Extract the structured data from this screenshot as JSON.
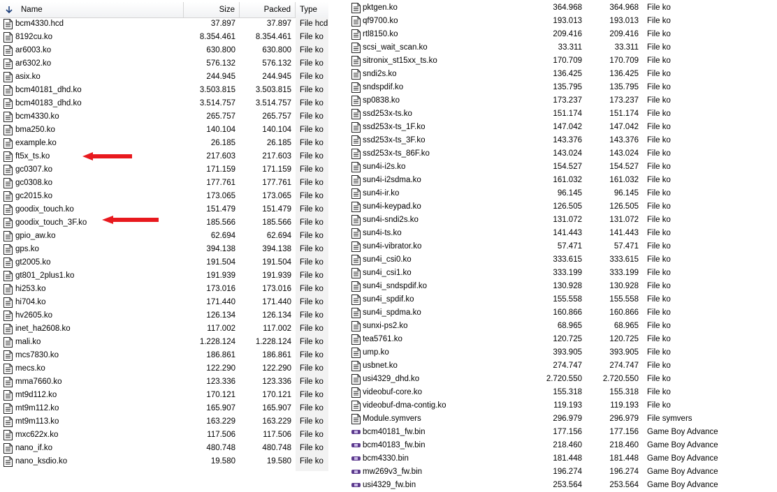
{
  "colors": {
    "annotation_arrow": "#e8191e",
    "gameboy_icon": "#5c3a8c",
    "type_column_shade": "#f2f2f2"
  },
  "header": {
    "name_label": "Name",
    "size_label": "Size",
    "packed_label": "Packed",
    "type_label": "Type",
    "sort_icon": "sort-down-arrow-icon"
  },
  "left_files": [
    {
      "name": "bcm4330.hcd",
      "size": "37.897",
      "packed": "37.897",
      "type": "File hcd",
      "icon": "document"
    },
    {
      "name": "8192cu.ko",
      "size": "8.354.461",
      "packed": "8.354.461",
      "type": "File ko",
      "icon": "document"
    },
    {
      "name": "ar6003.ko",
      "size": "630.800",
      "packed": "630.800",
      "type": "File ko",
      "icon": "document"
    },
    {
      "name": "ar6302.ko",
      "size": "576.132",
      "packed": "576.132",
      "type": "File ko",
      "icon": "document"
    },
    {
      "name": "asix.ko",
      "size": "244.945",
      "packed": "244.945",
      "type": "File ko",
      "icon": "document"
    },
    {
      "name": "bcm40181_dhd.ko",
      "size": "3.503.815",
      "packed": "3.503.815",
      "type": "File ko",
      "icon": "document"
    },
    {
      "name": "bcm40183_dhd.ko",
      "size": "3.514.757",
      "packed": "3.514.757",
      "type": "File ko",
      "icon": "document"
    },
    {
      "name": "bcm4330.ko",
      "size": "265.757",
      "packed": "265.757",
      "type": "File ko",
      "icon": "document"
    },
    {
      "name": "bma250.ko",
      "size": "140.104",
      "packed": "140.104",
      "type": "File ko",
      "icon": "document"
    },
    {
      "name": "example.ko",
      "size": "26.185",
      "packed": "26.185",
      "type": "File ko",
      "icon": "document"
    },
    {
      "name": "ft5x_ts.ko",
      "size": "217.603",
      "packed": "217.603",
      "type": "File ko",
      "icon": "document"
    },
    {
      "name": "gc0307.ko",
      "size": "171.159",
      "packed": "171.159",
      "type": "File ko",
      "icon": "document"
    },
    {
      "name": "gc0308.ko",
      "size": "177.761",
      "packed": "177.761",
      "type": "File ko",
      "icon": "document"
    },
    {
      "name": "gc2015.ko",
      "size": "173.065",
      "packed": "173.065",
      "type": "File ko",
      "icon": "document"
    },
    {
      "name": "goodix_touch.ko",
      "size": "151.479",
      "packed": "151.479",
      "type": "File ko",
      "icon": "document"
    },
    {
      "name": "goodix_touch_3F.ko",
      "size": "185.566",
      "packed": "185.566",
      "type": "File ko",
      "icon": "document"
    },
    {
      "name": "gpio_aw.ko",
      "size": "62.694",
      "packed": "62.694",
      "type": "File ko",
      "icon": "document"
    },
    {
      "name": "gps.ko",
      "size": "394.138",
      "packed": "394.138",
      "type": "File ko",
      "icon": "document"
    },
    {
      "name": "gt2005.ko",
      "size": "191.504",
      "packed": "191.504",
      "type": "File ko",
      "icon": "document"
    },
    {
      "name": "gt801_2plus1.ko",
      "size": "191.939",
      "packed": "191.939",
      "type": "File ko",
      "icon": "document"
    },
    {
      "name": "hi253.ko",
      "size": "173.016",
      "packed": "173.016",
      "type": "File ko",
      "icon": "document"
    },
    {
      "name": "hi704.ko",
      "size": "171.440",
      "packed": "171.440",
      "type": "File ko",
      "icon": "document"
    },
    {
      "name": "hv2605.ko",
      "size": "126.134",
      "packed": "126.134",
      "type": "File ko",
      "icon": "document"
    },
    {
      "name": "inet_ha2608.ko",
      "size": "117.002",
      "packed": "117.002",
      "type": "File ko",
      "icon": "document"
    },
    {
      "name": "mali.ko",
      "size": "1.228.124",
      "packed": "1.228.124",
      "type": "File ko",
      "icon": "document"
    },
    {
      "name": "mcs7830.ko",
      "size": "186.861",
      "packed": "186.861",
      "type": "File ko",
      "icon": "document"
    },
    {
      "name": "mecs.ko",
      "size": "122.290",
      "packed": "122.290",
      "type": "File ko",
      "icon": "document"
    },
    {
      "name": "mma7660.ko",
      "size": "123.336",
      "packed": "123.336",
      "type": "File ko",
      "icon": "document"
    },
    {
      "name": "mt9d112.ko",
      "size": "170.121",
      "packed": "170.121",
      "type": "File ko",
      "icon": "document"
    },
    {
      "name": "mt9m112.ko",
      "size": "165.907",
      "packed": "165.907",
      "type": "File ko",
      "icon": "document"
    },
    {
      "name": "mt9m113.ko",
      "size": "163.229",
      "packed": "163.229",
      "type": "File ko",
      "icon": "document"
    },
    {
      "name": "mxc622x.ko",
      "size": "117.506",
      "packed": "117.506",
      "type": "File ko",
      "icon": "document"
    },
    {
      "name": "nano_if.ko",
      "size": "480.748",
      "packed": "480.748",
      "type": "File ko",
      "icon": "document"
    },
    {
      "name": "nano_ksdio.ko",
      "size": "19.580",
      "packed": "19.580",
      "type": "File ko",
      "icon": "document"
    }
  ],
  "right_files": [
    {
      "name": "pktgen.ko",
      "size": "364.968",
      "packed": "364.968",
      "type": "File ko",
      "icon": "document"
    },
    {
      "name": "qf9700.ko",
      "size": "193.013",
      "packed": "193.013",
      "type": "File ko",
      "icon": "document"
    },
    {
      "name": "rtl8150.ko",
      "size": "209.416",
      "packed": "209.416",
      "type": "File ko",
      "icon": "document"
    },
    {
      "name": "scsi_wait_scan.ko",
      "size": "33.311",
      "packed": "33.311",
      "type": "File ko",
      "icon": "document"
    },
    {
      "name": "sitronix_st15xx_ts.ko",
      "size": "170.709",
      "packed": "170.709",
      "type": "File ko",
      "icon": "document"
    },
    {
      "name": "sndi2s.ko",
      "size": "136.425",
      "packed": "136.425",
      "type": "File ko",
      "icon": "document"
    },
    {
      "name": "sndspdif.ko",
      "size": "135.795",
      "packed": "135.795",
      "type": "File ko",
      "icon": "document"
    },
    {
      "name": "sp0838.ko",
      "size": "173.237",
      "packed": "173.237",
      "type": "File ko",
      "icon": "document"
    },
    {
      "name": "ssd253x-ts.ko",
      "size": "151.174",
      "packed": "151.174",
      "type": "File ko",
      "icon": "document"
    },
    {
      "name": "ssd253x-ts_1F.ko",
      "size": "147.042",
      "packed": "147.042",
      "type": "File ko",
      "icon": "document"
    },
    {
      "name": "ssd253x-ts_3F.ko",
      "size": "143.376",
      "packed": "143.376",
      "type": "File ko",
      "icon": "document"
    },
    {
      "name": "ssd253x-ts_86F.ko",
      "size": "143.024",
      "packed": "143.024",
      "type": "File ko",
      "icon": "document"
    },
    {
      "name": "sun4i-i2s.ko",
      "size": "154.527",
      "packed": "154.527",
      "type": "File ko",
      "icon": "document"
    },
    {
      "name": "sun4i-i2sdma.ko",
      "size": "161.032",
      "packed": "161.032",
      "type": "File ko",
      "icon": "document"
    },
    {
      "name": "sun4i-ir.ko",
      "size": "96.145",
      "packed": "96.145",
      "type": "File ko",
      "icon": "document"
    },
    {
      "name": "sun4i-keypad.ko",
      "size": "126.505",
      "packed": "126.505",
      "type": "File ko",
      "icon": "document"
    },
    {
      "name": "sun4i-sndi2s.ko",
      "size": "131.072",
      "packed": "131.072",
      "type": "File ko",
      "icon": "document"
    },
    {
      "name": "sun4i-ts.ko",
      "size": "141.443",
      "packed": "141.443",
      "type": "File ko",
      "icon": "document"
    },
    {
      "name": "sun4i-vibrator.ko",
      "size": "57.471",
      "packed": "57.471",
      "type": "File ko",
      "icon": "document"
    },
    {
      "name": "sun4i_csi0.ko",
      "size": "333.615",
      "packed": "333.615",
      "type": "File ko",
      "icon": "document"
    },
    {
      "name": "sun4i_csi1.ko",
      "size": "333.199",
      "packed": "333.199",
      "type": "File ko",
      "icon": "document"
    },
    {
      "name": "sun4i_sndspdif.ko",
      "size": "130.928",
      "packed": "130.928",
      "type": "File ko",
      "icon": "document"
    },
    {
      "name": "sun4i_spdif.ko",
      "size": "155.558",
      "packed": "155.558",
      "type": "File ko",
      "icon": "document"
    },
    {
      "name": "sun4i_spdma.ko",
      "size": "160.866",
      "packed": "160.866",
      "type": "File ko",
      "icon": "document"
    },
    {
      "name": "sunxi-ps2.ko",
      "size": "68.965",
      "packed": "68.965",
      "type": "File ko",
      "icon": "document"
    },
    {
      "name": "tea5761.ko",
      "size": "120.725",
      "packed": "120.725",
      "type": "File ko",
      "icon": "document"
    },
    {
      "name": "ump.ko",
      "size": "393.905",
      "packed": "393.905",
      "type": "File ko",
      "icon": "document"
    },
    {
      "name": "usbnet.ko",
      "size": "274.747",
      "packed": "274.747",
      "type": "File ko",
      "icon": "document"
    },
    {
      "name": "usi4329_dhd.ko",
      "size": "2.720.550",
      "packed": "2.720.550",
      "type": "File ko",
      "icon": "document"
    },
    {
      "name": "videobuf-core.ko",
      "size": "155.318",
      "packed": "155.318",
      "type": "File ko",
      "icon": "document"
    },
    {
      "name": "videobuf-dma-contig.ko",
      "size": "119.193",
      "packed": "119.193",
      "type": "File ko",
      "icon": "document"
    },
    {
      "name": "Module.symvers",
      "size": "296.979",
      "packed": "296.979",
      "type": "File symvers",
      "icon": "document"
    },
    {
      "name": "bcm40181_fw.bin",
      "size": "177.156",
      "packed": "177.156",
      "type": "Game Boy Advance",
      "icon": "gameboy"
    },
    {
      "name": "bcm40183_fw.bin",
      "size": "218.460",
      "packed": "218.460",
      "type": "Game Boy Advance",
      "icon": "gameboy"
    },
    {
      "name": "bcm4330.bin",
      "size": "181.448",
      "packed": "181.448",
      "type": "Game Boy Advance",
      "icon": "gameboy"
    },
    {
      "name": "mw269v3_fw.bin",
      "size": "196.274",
      "packed": "196.274",
      "type": "Game Boy Advance",
      "icon": "gameboy"
    },
    {
      "name": "usi4329_fw.bin",
      "size": "253.564",
      "packed": "253.564",
      "type": "Game Boy Advance",
      "icon": "gameboy"
    }
  ],
  "annotations": [
    {
      "icon": "red-arrow-icon",
      "points_to": "ft5x_ts.ko"
    },
    {
      "icon": "red-arrow-icon",
      "points_to": "goodix_touch_3F.ko"
    }
  ]
}
